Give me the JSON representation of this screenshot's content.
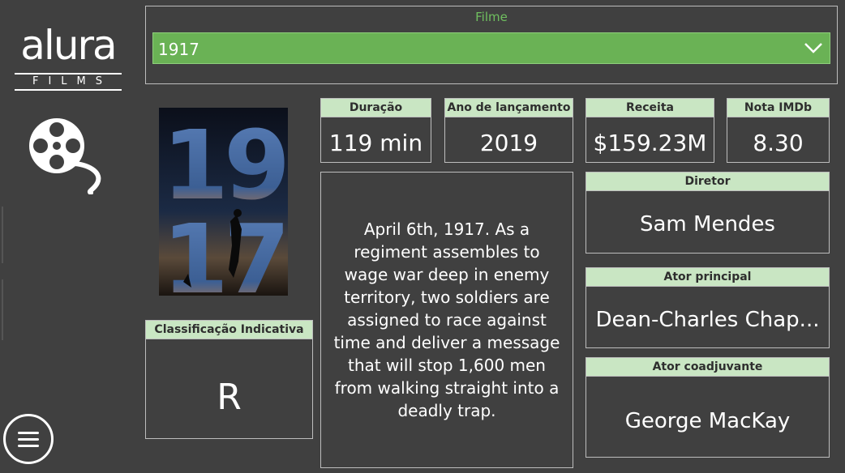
{
  "logo": {
    "word": "alura",
    "sub": "FILMS"
  },
  "filter": {
    "title": "Filme",
    "selected": "1917"
  },
  "poster": {
    "line1": "19",
    "line2": "17"
  },
  "stats": {
    "duration": {
      "label": "Duração",
      "value": "119 min"
    },
    "release_year": {
      "label": "Ano de lançamento",
      "value": "2019"
    },
    "revenue": {
      "label": "Receita",
      "value": "$159.23M"
    },
    "imdb": {
      "label": "Nota IMDb",
      "value": "8.30"
    }
  },
  "rating": {
    "label": "Classificação Indicativa",
    "value": "R"
  },
  "plot": "April 6th, 1917. As a regiment assembles to wage war deep in enemy territory, two soldiers are assigned to race against time and deliver a message that will stop 1,600 men from walking straight into a deadly trap.",
  "director": {
    "label": "Diretor",
    "value": "Sam Mendes"
  },
  "lead_actor": {
    "label": "Ator principal",
    "value": "Dean-Charles Chap..."
  },
  "supporting_actor": {
    "label": "Ator coadjuvante",
    "value": "George MacKay"
  },
  "colors": {
    "background": "#404040",
    "accent_green": "#6ab255",
    "header_green": "#c9e6c3",
    "filter_title": "#6fbf5f"
  }
}
